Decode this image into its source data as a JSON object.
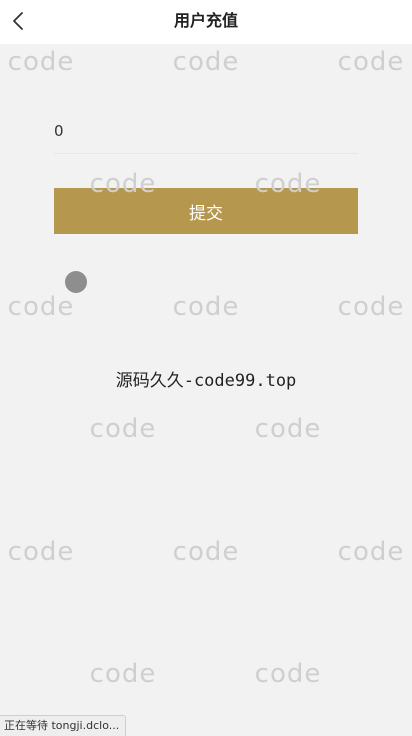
{
  "header": {
    "title": "用户充值",
    "back_icon": "chevron-left-icon"
  },
  "form": {
    "amount_value": "0",
    "submit_label": "提交"
  },
  "content": {
    "site_text": "源码久久-code99.top"
  },
  "watermark": {
    "text": "code"
  },
  "status": {
    "text": "正在等待 tongji.dclo..."
  },
  "colors": {
    "accent": "#b6974e",
    "background": "#f2f2f2",
    "header_bg": "#ffffff",
    "watermark": "#cfcfcf",
    "loading_dot": "#8e8e8e"
  }
}
